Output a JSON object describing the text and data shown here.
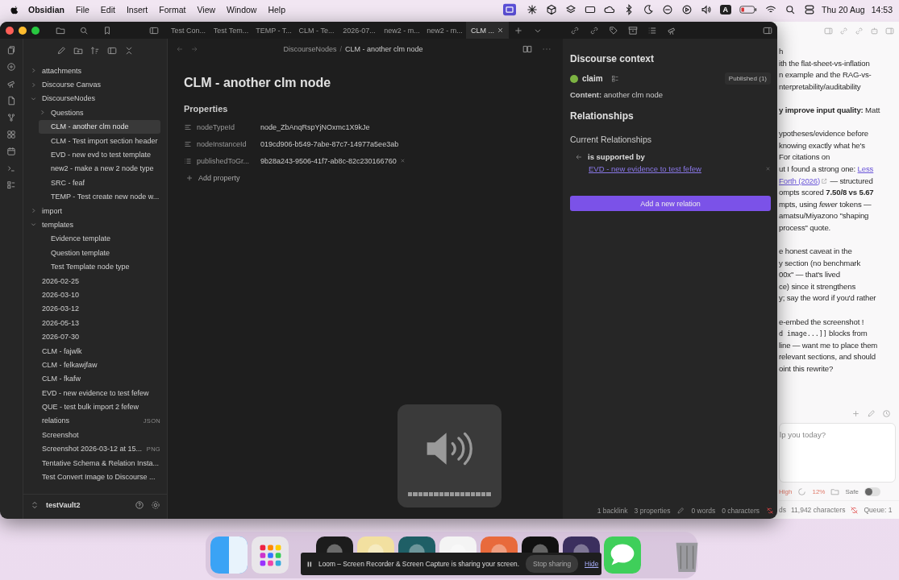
{
  "menu_bar": {
    "app": "Obsidian",
    "menus": [
      "File",
      "Edit",
      "Insert",
      "Format",
      "View",
      "Window",
      "Help"
    ],
    "input_source": "A",
    "date": "Thu 20 Aug",
    "time": "14:53"
  },
  "tabs": [
    {
      "label": "Test Con...",
      "selected": false
    },
    {
      "label": "Test Tem...",
      "selected": false
    },
    {
      "label": "TEMP - T...",
      "selected": false
    },
    {
      "label": "CLM - Te...",
      "selected": false
    },
    {
      "label": "2026-07...",
      "selected": false
    },
    {
      "label": "new2 - m...",
      "selected": false
    },
    {
      "label": "new2 - m...",
      "selected": false
    },
    {
      "label": "CLM ...",
      "selected": true
    }
  ],
  "sidebar": {
    "items": [
      {
        "label": "attachments",
        "kind": "folder",
        "expanded": false,
        "selected": false
      },
      {
        "label": "Discourse Canvas",
        "kind": "folder",
        "expanded": false,
        "selected": false
      },
      {
        "label": "DiscourseNodes",
        "kind": "folder",
        "expanded": true,
        "selected": false,
        "children": [
          {
            "label": "Questions",
            "kind": "folder",
            "expanded": false,
            "selected": false
          },
          {
            "label": "CLM - another clm node",
            "kind": "file",
            "selected": true
          },
          {
            "label": "CLM - Test import section header",
            "kind": "file",
            "selected": false
          },
          {
            "label": "EVD - new evd to test template",
            "kind": "file",
            "selected": false
          },
          {
            "label": "new2 - make a new 2 node type",
            "kind": "file",
            "selected": false
          },
          {
            "label": "SRC - feaf",
            "kind": "file",
            "selected": false
          },
          {
            "label": "TEMP - Test create new node w...",
            "kind": "file",
            "selected": false
          }
        ]
      },
      {
        "label": "import",
        "kind": "folder",
        "expanded": false,
        "selected": false
      },
      {
        "label": "templates",
        "kind": "folder",
        "expanded": true,
        "selected": false,
        "children": [
          {
            "label": "Evidence template",
            "kind": "file",
            "selected": false
          },
          {
            "label": "Question template",
            "kind": "file",
            "selected": false
          },
          {
            "label": "Test Template node type",
            "kind": "file",
            "selected": false
          }
        ]
      },
      {
        "label": "2026-02-25",
        "kind": "file",
        "selected": false
      },
      {
        "label": "2026-03-10",
        "kind": "file",
        "selected": false
      },
      {
        "label": "2026-03-12",
        "kind": "file",
        "selected": false
      },
      {
        "label": "2026-05-13",
        "kind": "file",
        "selected": false
      },
      {
        "label": "2026-07-30",
        "kind": "file",
        "selected": false
      },
      {
        "label": "CLM - fajwlk",
        "kind": "file",
        "selected": false
      },
      {
        "label": "CLM - felkawjfaw",
        "kind": "file",
        "selected": false
      },
      {
        "label": "CLM - fkafw",
        "kind": "file",
        "selected": false
      },
      {
        "label": "EVD - new evidence to test fefew",
        "kind": "file",
        "selected": false
      },
      {
        "label": "QUE - test bulk import 2 fefew",
        "kind": "file",
        "selected": false
      },
      {
        "label": "relations",
        "kind": "file",
        "selected": false,
        "badge": "JSON"
      },
      {
        "label": "Screenshot",
        "kind": "file",
        "selected": false
      },
      {
        "label": "Screenshot 2026-03-12 at 15...",
        "kind": "file",
        "selected": false,
        "badge": "PNG"
      },
      {
        "label": "Tentative Schema & Relation Insta...",
        "kind": "file",
        "selected": false
      },
      {
        "label": "Test Convert Image to Discourse ...",
        "kind": "file",
        "selected": false
      }
    ],
    "vault": "testVault2"
  },
  "editor": {
    "breadcrumb": {
      "folder": "DiscourseNodes",
      "separator": "/",
      "note": "CLM - another clm node"
    },
    "title": "CLM - another clm node",
    "properties_heading": "Properties",
    "properties": [
      {
        "name": "nodeTypeId",
        "value": "node_ZbAnqRspYjNOxmc1X9kJe",
        "kind": "text",
        "removable": false
      },
      {
        "name": "nodeInstanceId",
        "value": "019cd906-b549-7abe-87c7-14977a5ee3ab",
        "kind": "text",
        "removable": false
      },
      {
        "name": "publishedToGr...",
        "value": "9b28a243-9506-41f7-ab8c-82c230166760",
        "kind": "list",
        "removable": true
      }
    ],
    "add_property": "Add property"
  },
  "volume_hud": {
    "level": 1
  },
  "discourse_context": {
    "title": "Discourse context",
    "node_type": "claim",
    "badge": "Published (1)",
    "content": "**Content:** another clm node",
    "relationships_heading": "Relationships",
    "current_heading": "Current Relationships",
    "relations": [
      {
        "label": "is supported by",
        "target": "EVD - new evidence to test fefew"
      }
    ],
    "add_button": "Add a new relation"
  },
  "status_bar": [
    "1 backlink",
    "3 properties",
    "0 words",
    "0 characters"
  ],
  "chat_window": {
    "paragraphs": [
      {
        "lines": [
          {
            "segments": [
              {
                "kind": "plain",
                "text": "h"
              }
            ]
          },
          {
            "segments": [
              {
                "kind": "plain",
                "text": "ith the flat-sheet-vs-inflation"
              }
            ]
          },
          {
            "segments": [
              {
                "kind": "plain",
                "text": "n example and the RAG-vs-"
              }
            ]
          },
          {
            "segments": [
              {
                "kind": "plain",
                "text": "nterpretability/auditability"
              }
            ]
          }
        ]
      },
      {
        "lines": [
          {
            "segments": [
              {
                "kind": "plain",
                "text": "**y improve input quality:** Matt"
              }
            ]
          }
        ]
      },
      {
        "lines": [
          {
            "segments": [
              {
                "kind": "plain",
                "text": "ypotheses/evidence before"
              }
            ]
          },
          {
            "segments": [
              {
                "kind": "plain",
                "text": "knowing exactly what he's"
              }
            ]
          },
          {
            "segments": [
              {
                "kind": "plain",
                "text": "For citations on"
              }
            ]
          },
          {
            "segments": [
              {
                "kind": "plain",
                "text": "ut I found a strong one: "
              },
              {
                "kind": "link",
                "text": "Less"
              }
            ]
          },
          {
            "segments": [
              {
                "kind": "link",
                "text": "Forth (2026)"
              },
              {
                "kind": "plain",
                "text": " — structured"
              }
            ]
          },
          {
            "segments": [
              {
                "kind": "plain",
                "text": "ompts scored **7.50/8 vs 5.67**"
              }
            ]
          },
          {
            "segments": [
              {
                "kind": "plain",
                "text": "mpts, using *fewer* tokens —"
              }
            ]
          },
          {
            "segments": [
              {
                "kind": "plain",
                "text": "amatsu/Miyazono \"shaping"
              }
            ]
          },
          {
            "segments": [
              {
                "kind": "plain",
                "text": "process\" quote."
              }
            ]
          }
        ]
      },
      {
        "lines": [
          {
            "segments": [
              {
                "kind": "plain",
                "text": "e honest caveat in the"
              }
            ]
          },
          {
            "segments": [
              {
                "kind": "plain",
                "text": "y section (no benchmark"
              }
            ]
          },
          {
            "segments": [
              {
                "kind": "plain",
                "text": "00x\" — that's lived"
              }
            ]
          },
          {
            "segments": [
              {
                "kind": "plain",
                "text": "ce) since it strengthens"
              }
            ]
          },
          {
            "segments": [
              {
                "kind": "plain",
                "text": "y; say the word if you'd rather"
              }
            ]
          }
        ]
      },
      {
        "lines": [
          {
            "segments": [
              {
                "kind": "plain",
                "text": "e-embed the screenshot !"
              }
            ]
          },
          {
            "segments": [
              {
                "kind": "code",
                "text": "d image...]]"
              },
              {
                "kind": "plain",
                "text": " blocks from"
              }
            ]
          },
          {
            "segments": [
              {
                "kind": "plain",
                "text": "line — want me to place them"
              }
            ]
          },
          {
            "segments": [
              {
                "kind": "plain",
                "text": "relevant sections, and should"
              }
            ]
          },
          {
            "segments": [
              {
                "kind": "plain",
                "text": "oint this rewrite?"
              }
            ]
          }
        ]
      }
    ],
    "placeholder": "lp you today?",
    "effort": "High",
    "context": "12%",
    "mode": "Safe",
    "mode_on": false,
    "status_cut": "ds",
    "characters": "11,942 characters",
    "queue": "Queue: 1"
  },
  "loom_bar": {
    "message": "Loom – Screen Recorder & Screen Capture is sharing your screen.",
    "stop": "Stop sharing",
    "hide": "Hide"
  }
}
